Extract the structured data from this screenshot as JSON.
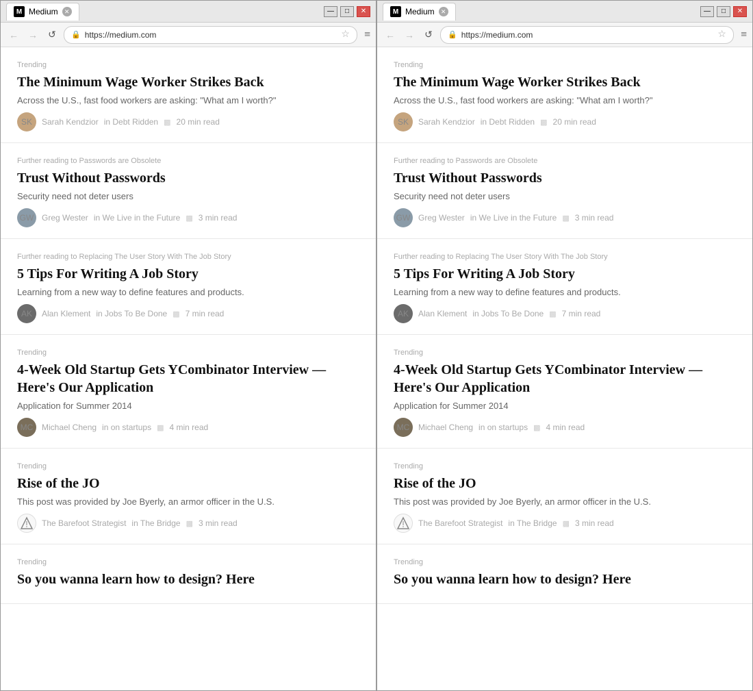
{
  "windows": [
    {
      "id": "window-left",
      "title": "Medium",
      "url": "https://medium.com",
      "articles": [
        {
          "label": "Trending",
          "title": "The Minimum Wage Worker Strikes Back",
          "subtitle": "Across the U.S., fast food workers are asking: \"What am I worth?\"",
          "author": "Sarah Kendzior",
          "publication": "in Debt Ridden",
          "read_time": "20 min read",
          "avatar_color": "sarah"
        },
        {
          "label": "Further reading to Passwords are Obsolete",
          "title": "Trust Without Passwords",
          "subtitle": "Security need not deter users",
          "author": "Greg Wester",
          "publication": "in We Live in the Future",
          "read_time": "3 min read",
          "avatar_color": "greg"
        },
        {
          "label": "Further reading to Replacing The User Story With The Job Story",
          "title": "5 Tips For Writing A Job Story",
          "subtitle": "Learning from a new way to define features and products.",
          "author": "Alan Klement",
          "publication": "in Jobs To Be Done",
          "read_time": "7 min read",
          "avatar_color": "alan"
        },
        {
          "label": "Trending",
          "title": "4-Week Old Startup Gets YCombinator Interview — Here's Our Application",
          "subtitle": "Application for Summer 2014",
          "author": "Michael Cheng",
          "publication": "in on startups",
          "read_time": "4 min read",
          "avatar_color": "michael"
        },
        {
          "label": "Trending",
          "title": "Rise of the JO",
          "subtitle": "This post was provided by Joe Byerly, an armor officer in the U.S.",
          "author": "The Barefoot Strategist",
          "publication": "in The Bridge",
          "read_time": "3 min read",
          "avatar_color": "barefoot"
        },
        {
          "label": "Trending",
          "title": "So you wanna learn how to design? Here",
          "subtitle": "",
          "author": "",
          "publication": "",
          "read_time": "",
          "avatar_color": ""
        }
      ]
    }
  ],
  "nav": {
    "back": "←",
    "forward": "→",
    "reload": "↺",
    "menu": "≡",
    "star": "☆",
    "ssl": "🔒",
    "close_x": "✕",
    "minimize": "—",
    "maximize": "□"
  }
}
